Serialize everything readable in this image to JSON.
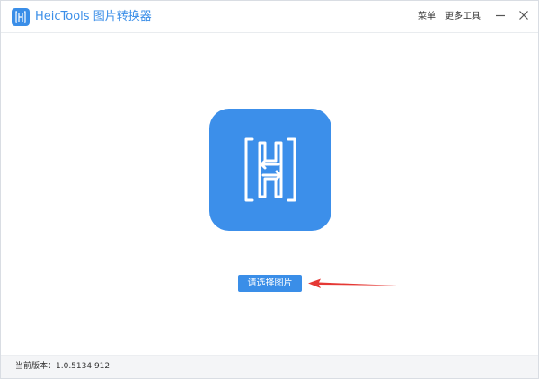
{
  "app": {
    "title": "HeicTools 图片转换器",
    "accent_color": "#3a8ee8",
    "logo_icon": "heic-logo-icon"
  },
  "header": {
    "menu_label": "菜单",
    "more_tools_label": "更多工具",
    "minimize_icon": "minimize-icon",
    "close_icon": "close-icon"
  },
  "main": {
    "hero_icon": "heic-convert-icon",
    "select_button_label": "请选择图片",
    "pointer_icon": "red-arrow-icon",
    "pointer_color": "#e53935"
  },
  "status": {
    "version_text": "当前版本：1.0.5134.912"
  }
}
